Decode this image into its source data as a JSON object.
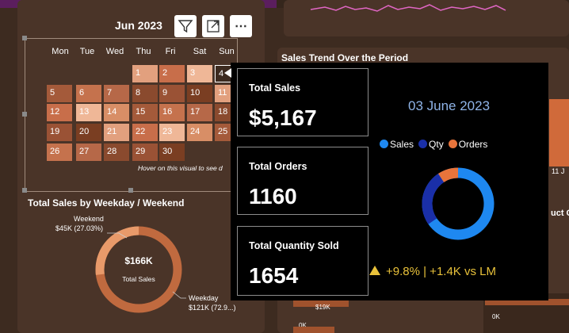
{
  "calendar": {
    "month_title": "Jun 2023",
    "toolbar": {
      "filter_icon": "filter-icon",
      "focus_icon": "focus-mode-icon",
      "more_icon": "more-options-icon",
      "more_label": "⋯"
    },
    "weekdays": [
      "Mon",
      "Tue",
      "Wed",
      "Thu",
      "Fri",
      "Sat",
      "Sun"
    ],
    "days": [
      "1",
      "2",
      "3",
      "4",
      "5",
      "6",
      "7",
      "8",
      "9",
      "10",
      "11",
      "12",
      "13",
      "14",
      "15",
      "16",
      "17",
      "18",
      "19",
      "20",
      "21",
      "22",
      "23",
      "24",
      "25",
      "26",
      "27",
      "28",
      "29",
      "30"
    ],
    "hover_note": "Hover on this visual to see d"
  },
  "weekday_weekend": {
    "title": "Total Sales by Weekday / Weekend",
    "weekend_label": "Weekend",
    "weekend_value": "$45K (27.03%)",
    "weekday_label": "Weekday",
    "weekday_value": "$121K (72.9...)",
    "center_value": "$166K",
    "center_label": "Total Sales",
    "weekend_share": 0.2703
  },
  "sales_trend": {
    "title": "Sales Trend Over the Period"
  },
  "right_side": {
    "title_fragment": "uct C",
    "axis_label": "11 J"
  },
  "bottom_bars": {
    "bar_label": "$19K",
    "axis_left": "0K",
    "axis_right": "0K"
  },
  "tooltip": {
    "total_sales_label": "Total Sales",
    "total_sales_value": "$5,167",
    "total_orders_label": "Total Orders",
    "total_orders_value": "1160",
    "total_qty_label": "Total Quantity Sold",
    "total_qty_value": "1654",
    "date": "03 June 2023",
    "legend": [
      {
        "label": "Sales",
        "color": "#1e88f0"
      },
      {
        "label": "Qty",
        "color": "#1a2fa8"
      },
      {
        "label": "Orders",
        "color": "#e8743b"
      }
    ],
    "trend_text": "+9.8% | +1.4K vs LM",
    "trend_icon": "warning-triangle-icon"
  },
  "colors": {
    "background": "#3d2b20",
    "panel": "#4a3428",
    "accent": "#e8c13a"
  }
}
